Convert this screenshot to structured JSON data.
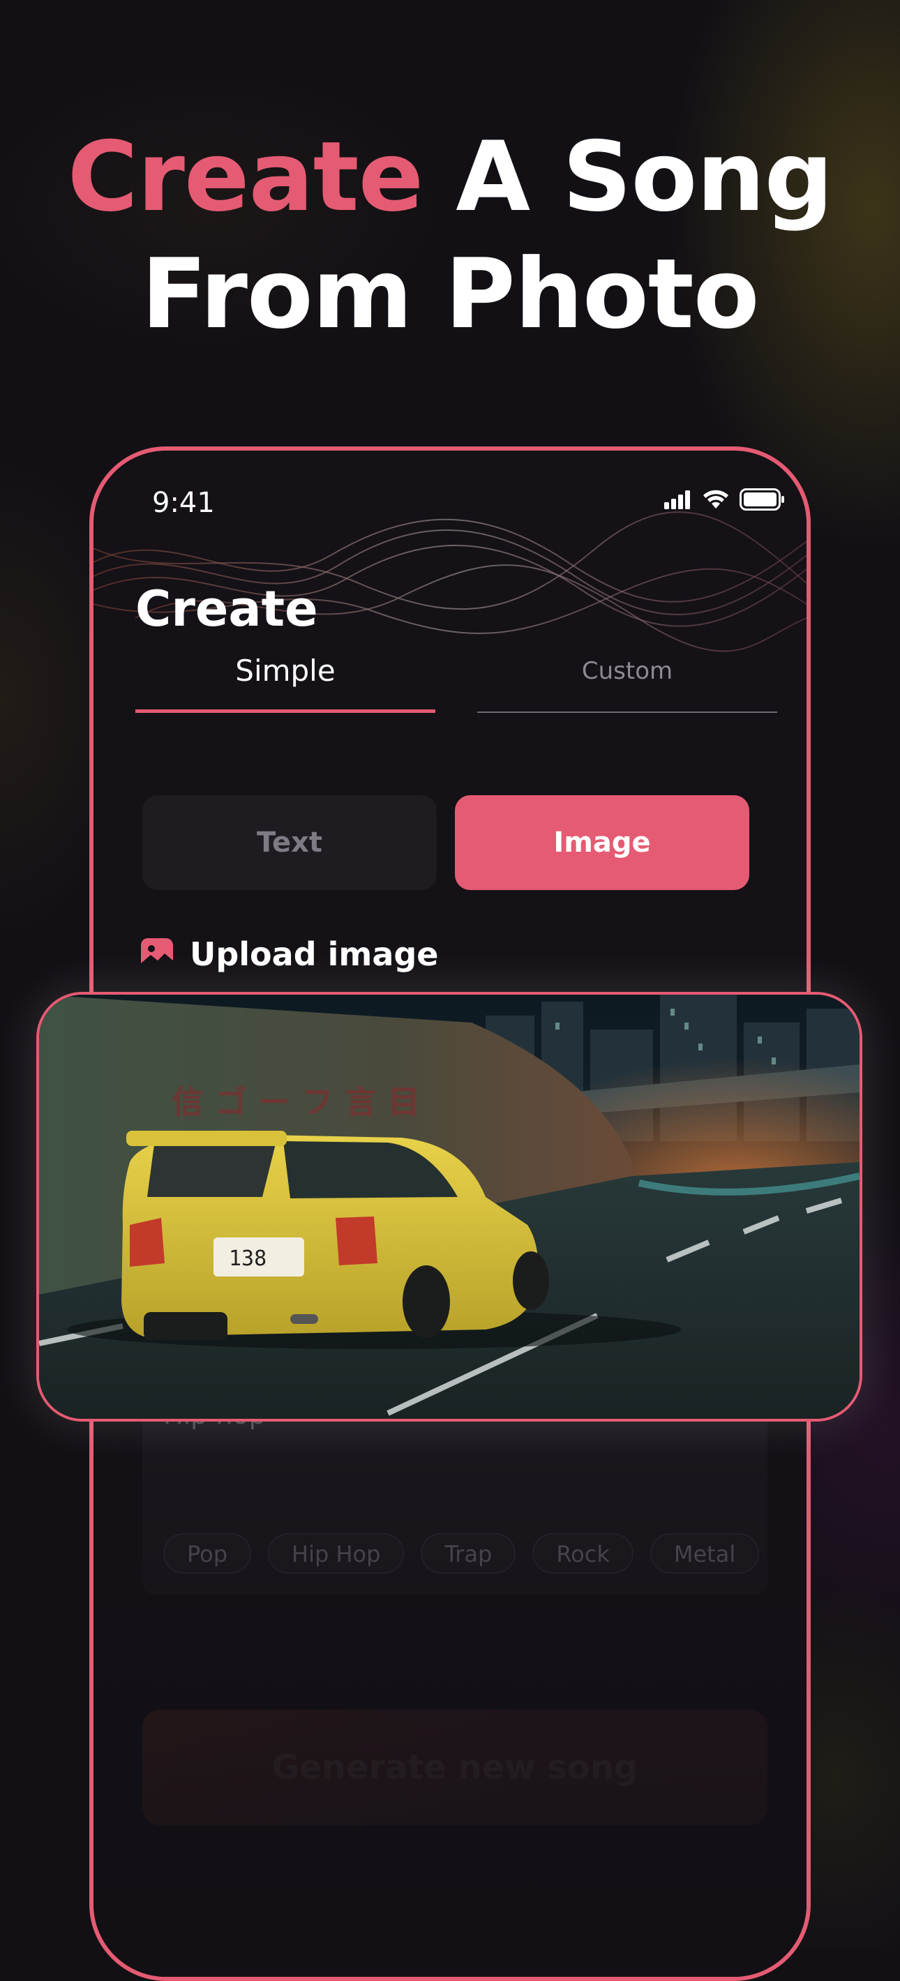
{
  "headline": {
    "accent": "Create",
    "rest_line1": " A Song",
    "line2": "From Photo"
  },
  "status_bar": {
    "time": "9:41"
  },
  "screen": {
    "title": "Create",
    "tabs": [
      {
        "label": "Simple",
        "active": true
      },
      {
        "label": "Custom",
        "active": false
      }
    ],
    "segments": [
      {
        "label": "Text",
        "selected": false
      },
      {
        "label": "Image",
        "selected": true
      }
    ],
    "upload_label": "Upload image",
    "genre_value": "Hip hop",
    "genre_chips": [
      "Pop",
      "Hip Hop",
      "Trap",
      "Rock",
      "Metal"
    ],
    "generate_label": "Generate new song"
  },
  "photo": {
    "sign_text": "信 ゴ ー フ 言 目",
    "plate_text": "138"
  },
  "colors": {
    "accent": "#E55B73",
    "background": "#121015",
    "segment_inactive": "#1e1b21"
  },
  "icons": [
    "signal-icon",
    "wifi-icon",
    "battery-icon",
    "image-upload-icon"
  ]
}
